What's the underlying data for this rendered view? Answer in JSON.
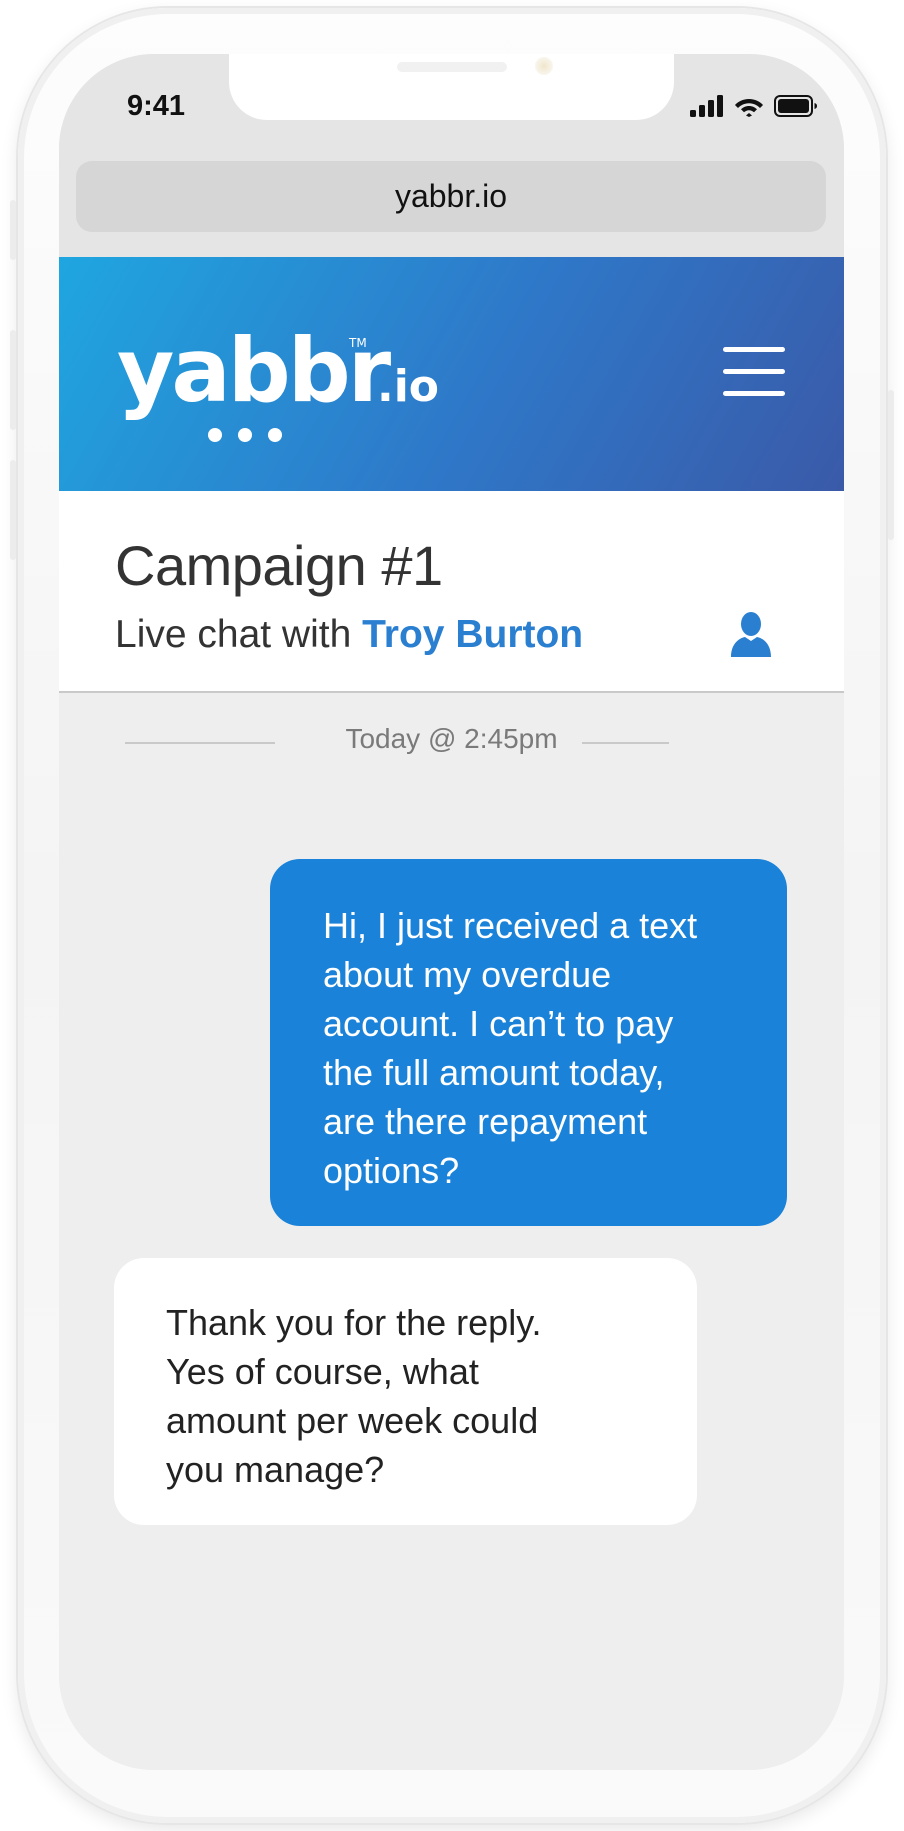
{
  "status_bar": {
    "time": "9:41",
    "icons": [
      "cellular-signal-icon",
      "wifi-icon",
      "battery-icon"
    ]
  },
  "browser": {
    "url": "yabbr.io"
  },
  "header": {
    "logo_text": "yabbr",
    "logo_suffix": ".io",
    "logo_trademark": "TM",
    "menu_icon": "hamburger-menu-icon",
    "colors": {
      "gradient_start": "#1fa6e0",
      "gradient_end": "#3a5aa8"
    }
  },
  "campaign": {
    "title": "Campaign #1",
    "subtitle_prefix": "Live chat with",
    "contact_name": "Troy Burton",
    "profile_icon": "user-profile-icon",
    "accent_color": "#2a7fd0"
  },
  "chat": {
    "timestamp": "Today @ 2:45pm",
    "messages": [
      {
        "direction": "outgoing",
        "lines": [
          "Hi, I just received a text",
          "about my overdue",
          "account. I can’t to pay",
          "the full amount today,",
          "are there repayment",
          "options?"
        ],
        "color": "#1a82d8"
      },
      {
        "direction": "incoming",
        "lines": [
          "Thank you for the reply.",
          "Yes of course, what",
          "amount per week could",
          "you manage?"
        ],
        "color": "#ffffff"
      }
    ]
  }
}
